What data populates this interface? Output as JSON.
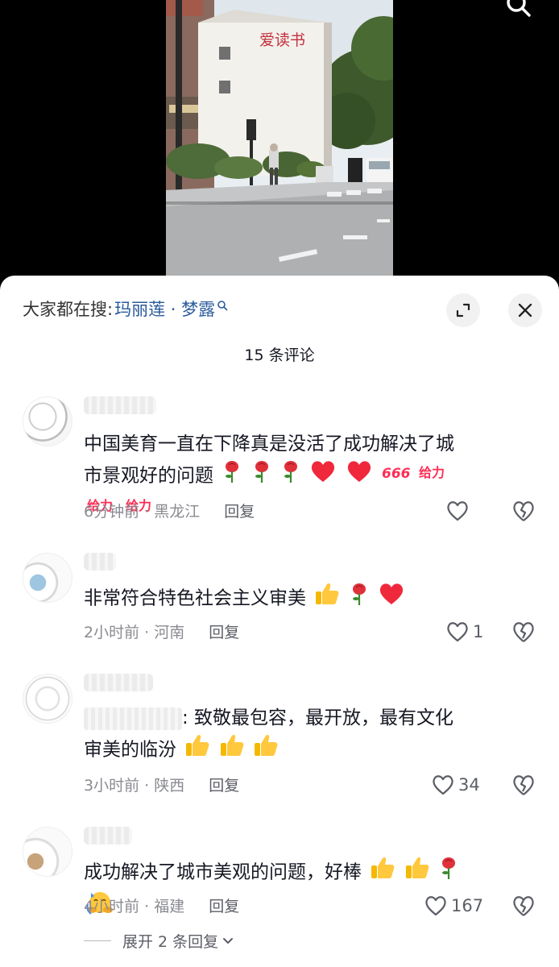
{
  "photo": {
    "sign_text": "爱读书"
  },
  "header": {
    "hot_search_label": "大家都在搜:",
    "hot_search_term": "玛丽莲 · 梦露",
    "comment_count": "15 条评论"
  },
  "comments": [
    {
      "text": "中国美育一直在下降真是没活了成功解决了城市景观好的问题",
      "emojis": [
        "rose",
        "rose",
        "rose",
        "heart",
        "heart",
        "666",
        "给力",
        "给力",
        "给力"
      ],
      "time_location": "6分钟前 · 黑龙江",
      "reply_label": "回复",
      "likes": ""
    },
    {
      "text": "非常符合特色社会主义审美",
      "emojis": [
        "thumbs-up",
        "rose",
        "heart"
      ],
      "time_location": "2小时前 · 河南",
      "reply_label": "回复",
      "likes": "1"
    },
    {
      "text_suffix": ": 致敬最包容，最开放，最有文化审美的临汾",
      "emojis": [
        "thumbs-up",
        "thumbs-up",
        "thumbs-up"
      ],
      "time_location": "3小时前 · 陕西",
      "reply_label": "回复",
      "likes": "34"
    },
    {
      "text": "成功解决了城市美观的问题，好棒",
      "emojis": [
        "thumbs-up",
        "thumbs-up",
        "rose",
        "hug"
      ],
      "time_location": "4小时前 · 福建",
      "reply_label": "回复",
      "likes": "167"
    }
  ],
  "expand_replies_label": "展开 2 条回复",
  "colors": {
    "accent_link": "#2a5a9b",
    "heart_red": "#f0283c",
    "text_secondary": "#8a8b91"
  }
}
